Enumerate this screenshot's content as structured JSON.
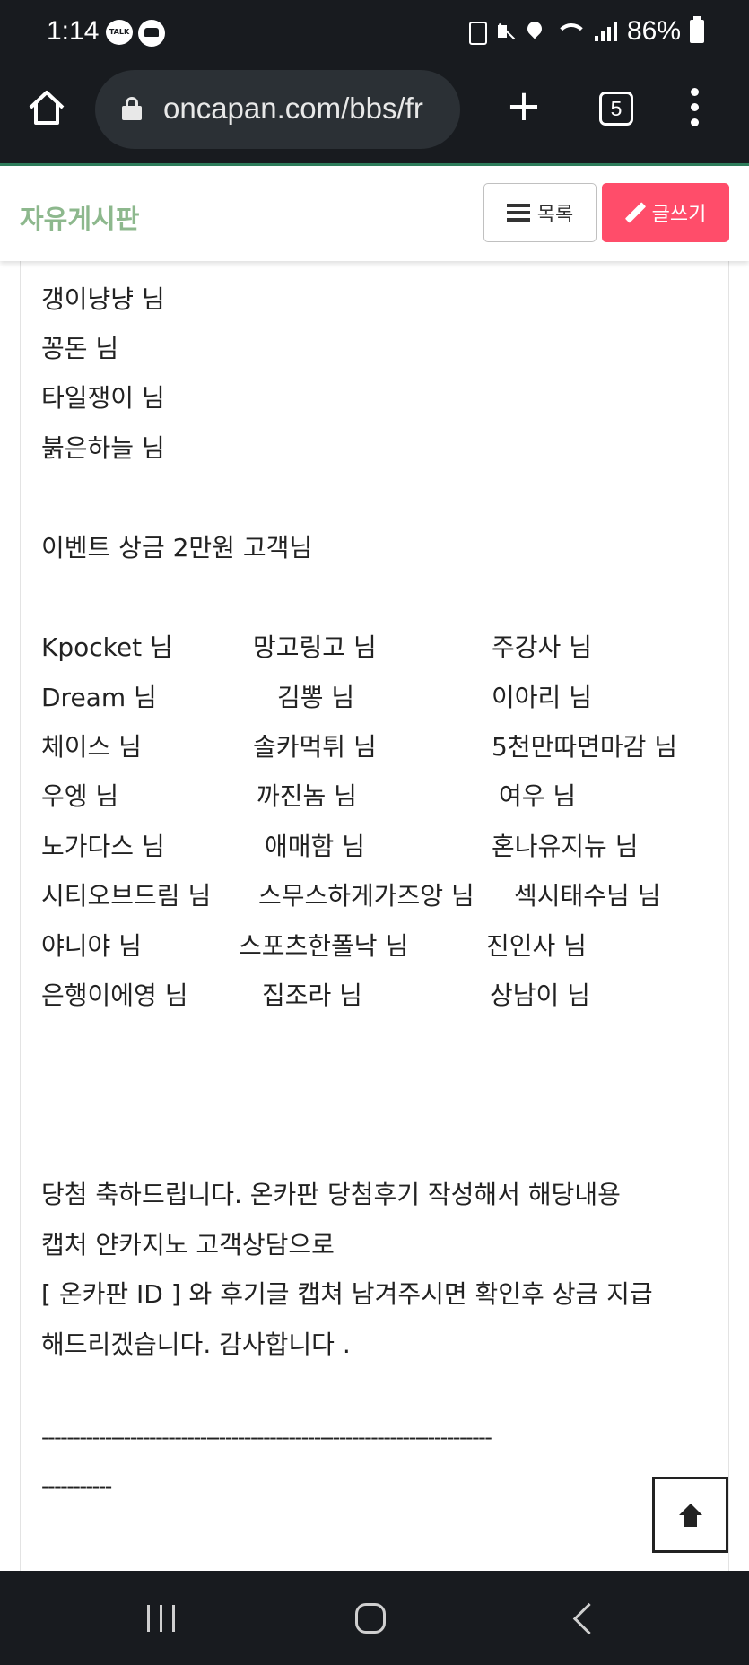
{
  "status_bar": {
    "time": "1:14",
    "talk_badge": "TALK",
    "battery": "86%"
  },
  "browser": {
    "url": "oncapan.com/bbs/fr",
    "tab_count": "5",
    "new_tab_symbol": "+"
  },
  "board": {
    "title": "자유게시판",
    "list_button": "목록",
    "write_button": "글쓰기"
  },
  "post": {
    "top_names": [
      "갱이냥냥 님",
      "꽁돈 님",
      "타일쟁이 님",
      "붉은하늘 님"
    ],
    "prize_heading": "이벤트 상금  2만원 고객님",
    "winners": [
      [
        "Kpocket 님",
        "망고링고 님",
        "주강사 님"
      ],
      [
        "Dream 님",
        "김뽕 님",
        "이아리 님"
      ],
      [
        "체이스 님",
        "솔카먹튀 님",
        "5천만따면마감 님"
      ],
      [
        "우엥 님",
        "까진놈 님",
        "여우 님"
      ],
      [
        "노가다스 님",
        "애매함 님",
        "혼나유지뉴 님"
      ],
      [
        "시티오브드림 님",
        "스무스하게가즈앙 님",
        "섹시태수님 님"
      ],
      [
        "야니야 님",
        "스포츠한폴낙 님",
        "진인사 님"
      ],
      [
        "은행이에영 님",
        "집조라 님",
        "상남이 님"
      ]
    ],
    "notice": [
      "당첨 축하드립니다. 온카판 당첨후기 작성해서 해당내용",
      "캡처 얀카지노 고객상담으로",
      "[ 온카판 ID ] 와 후기글 캡쳐 남겨주시면 확인후 상금 지급",
      "해드리겠습니다. 감사합니다 ."
    ],
    "divider_line1": "-----------------------------------------------------------------------",
    "divider_line2": "-----------"
  }
}
